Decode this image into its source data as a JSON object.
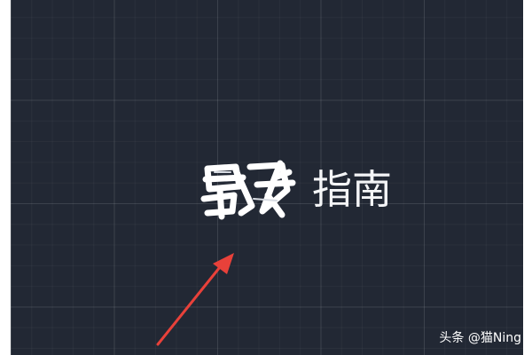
{
  "cad_canvas": {
    "visible_text": "指南",
    "scribbled_text_color": "#ffffff",
    "background_color": "#222834",
    "grid_color": "#3a4252"
  },
  "annotation_arrow": {
    "icon": "arrow-up-right-icon",
    "color": "#e8413a"
  },
  "watermark": {
    "text": "头条 @猫Ning"
  }
}
